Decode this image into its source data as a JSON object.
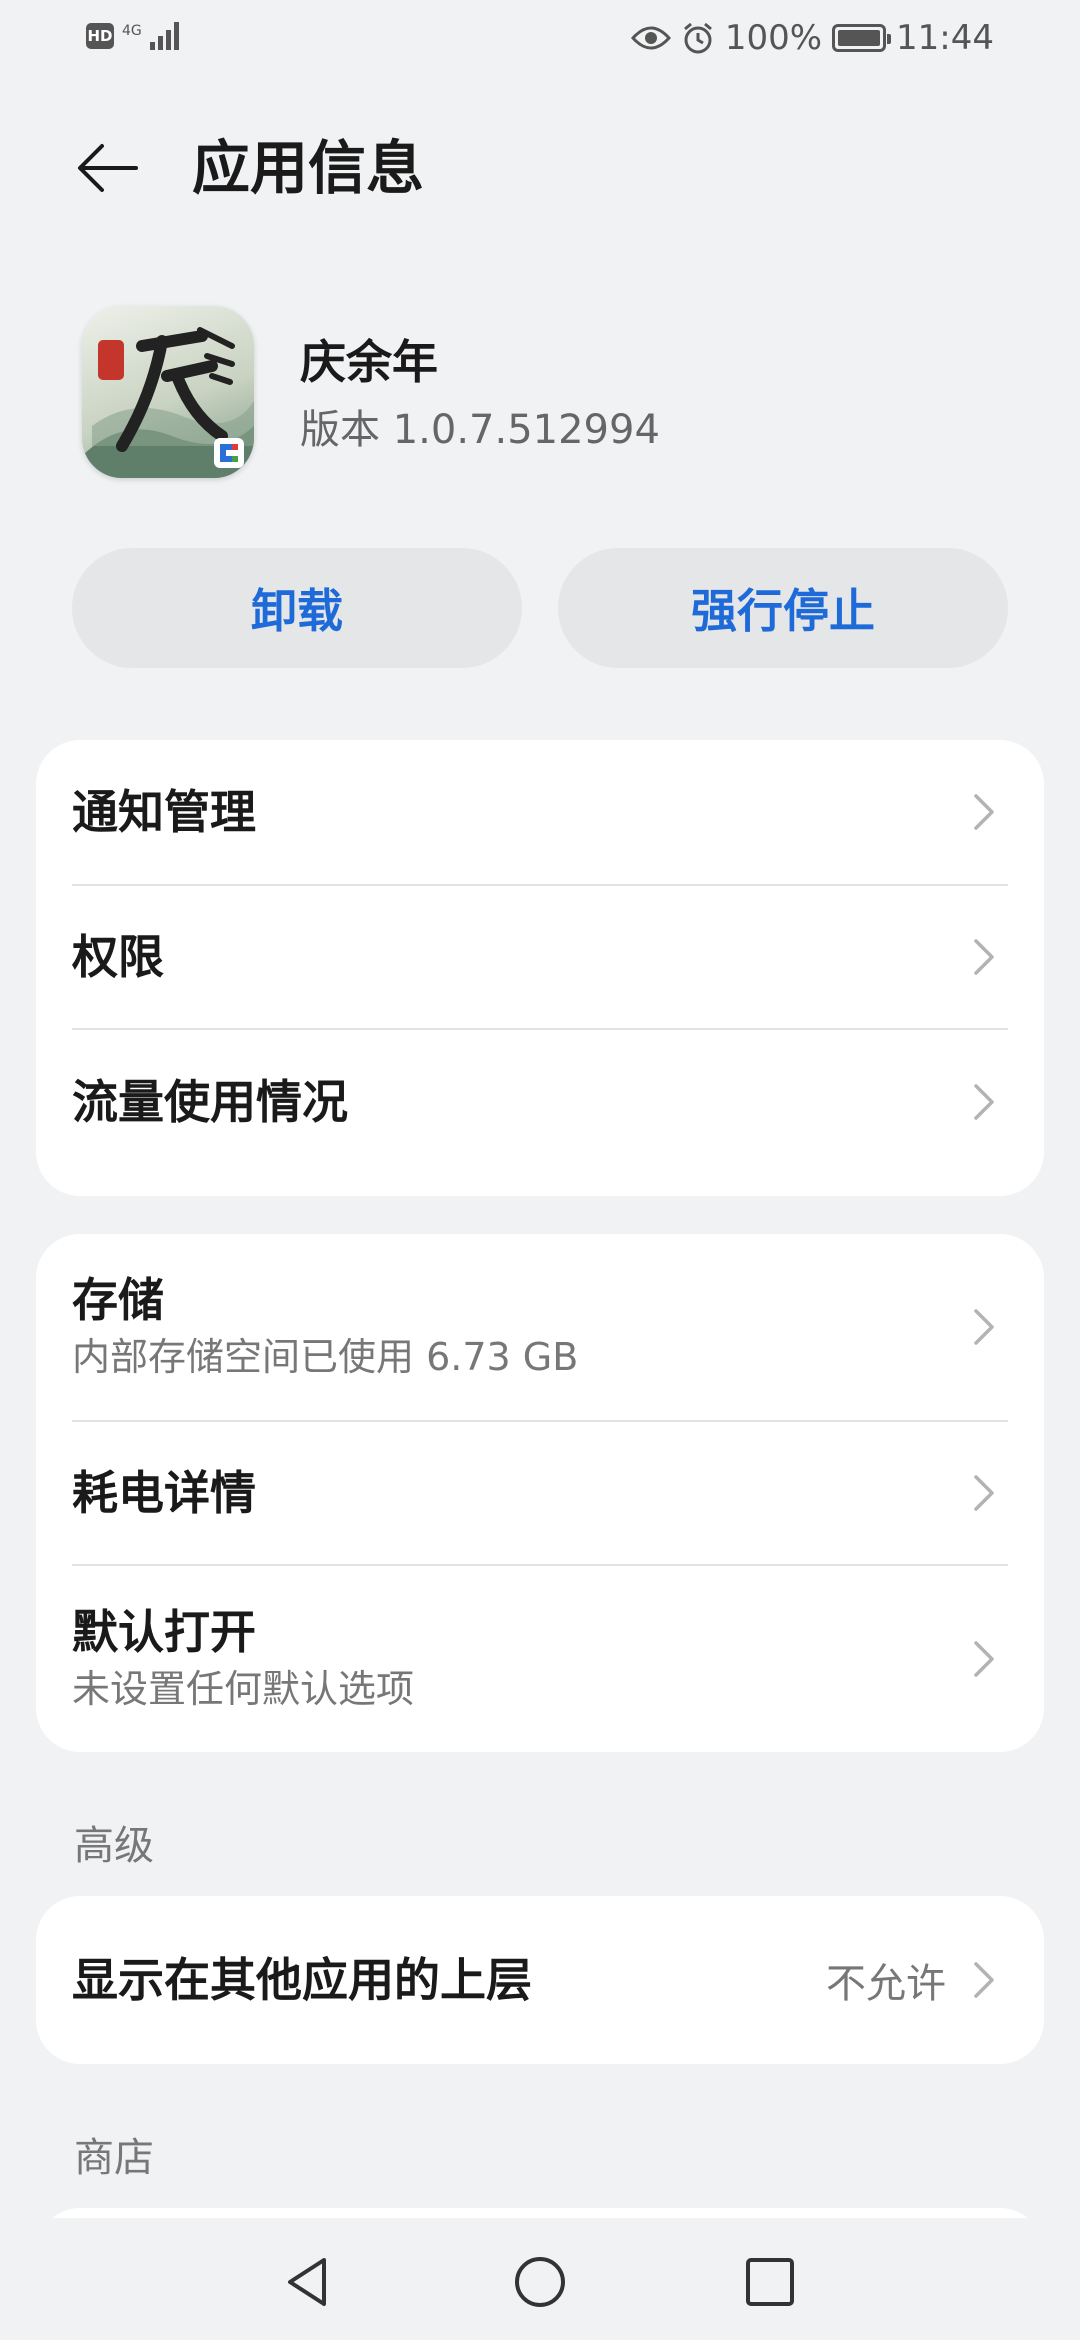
{
  "status_bar": {
    "hd": "HD",
    "network": "4G",
    "battery": "100%",
    "battery_level": 1.0,
    "time": "11:44"
  },
  "header": {
    "back_icon": "arrow-left-icon",
    "title": "应用信息"
  },
  "app": {
    "name": "庆余年",
    "version": "版本 1.0.7.512994",
    "icon": "app-icon-qingyunian"
  },
  "actions": {
    "uninstall": "卸载",
    "force_stop": "强行停止",
    "accent": "#1e6ad9"
  },
  "card1": {
    "items": [
      {
        "title": "通知管理"
      },
      {
        "title": "权限"
      },
      {
        "title": "流量使用情况"
      }
    ]
  },
  "card2": {
    "storage": {
      "title": "存储",
      "subtitle": "内部存储空间已使用 6.73 GB"
    },
    "battery": {
      "title": "耗电详情"
    },
    "default_open": {
      "title": "默认打开",
      "subtitle": "未设置任何默认选项"
    }
  },
  "advanced": {
    "label": "高级",
    "overlay": {
      "title": "显示在其他应用的上层",
      "value": "不允许"
    }
  },
  "store": {
    "label": "商店"
  },
  "nav": {
    "back": "triangle-back-icon",
    "home": "circle-home-icon",
    "recents": "square-recents-icon"
  }
}
